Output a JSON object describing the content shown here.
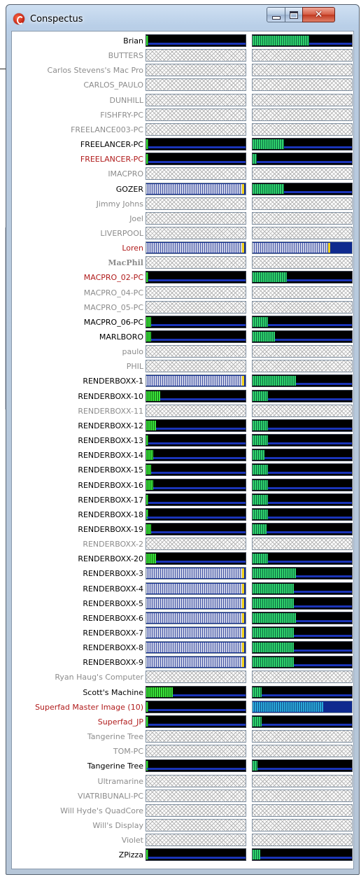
{
  "window": {
    "title": "Conspectus",
    "controls": {
      "minimize": "minimize",
      "maximize": "maximize",
      "close": "close"
    }
  },
  "colors": {
    "active_text": "#000000",
    "offline_text": "#8c8c8c",
    "error_text": "#b01c1c",
    "cpu_fill": "#3be23b",
    "mem_fill": "#2fd06b",
    "busy_fill": "#c9cfe6",
    "busy_cap": "#f2d21a",
    "graph_line": "#1e3dd8"
  },
  "machines": [
    {
      "name": "Brian",
      "state": "active",
      "cpu": 0.02,
      "mem": 0.58
    },
    {
      "name": "BUTTERS",
      "state": "offline"
    },
    {
      "name": "Carlos Stevens's Mac Pro",
      "state": "offline"
    },
    {
      "name": "CARLOS_PAULO",
      "state": "offline"
    },
    {
      "name": "DUNHILL",
      "state": "offline"
    },
    {
      "name": "FISHFRY-PC",
      "state": "offline"
    },
    {
      "name": "FREELANCE003-PC",
      "state": "offline"
    },
    {
      "name": "FREELANCER-PC",
      "state": "active",
      "cpu": 0.02,
      "mem": 0.32
    },
    {
      "name": "FREELANCER-PC",
      "state": "error",
      "cpu": 0.02,
      "mem": 0.04
    },
    {
      "name": "IMACPRO",
      "state": "offline"
    },
    {
      "name": "GOZER",
      "state": "busy",
      "cpu": 1.0,
      "mem": 0.32
    },
    {
      "name": "Jimmy Johns",
      "state": "offline"
    },
    {
      "name": "Joel",
      "state": "offline"
    },
    {
      "name": "LIVERPOOL",
      "state": "offline"
    },
    {
      "name": "Loren",
      "state": "error-busy",
      "cpu": 1.0,
      "mem": 0.77
    },
    {
      "name": "MacPhil",
      "state": "bold-offline"
    },
    {
      "name": "MACPRO_02-PC",
      "state": "error",
      "cpu": 0.02,
      "mem": 0.35
    },
    {
      "name": "MACPRO_04-PC",
      "state": "offline"
    },
    {
      "name": "MACPRO_05-PC",
      "state": "offline"
    },
    {
      "name": "MACPRO_06-PC",
      "state": "active",
      "cpu": 0.05,
      "mem": 0.16
    },
    {
      "name": "MARLBORO",
      "state": "active",
      "cpu": 0.05,
      "mem": 0.23
    },
    {
      "name": "paulo",
      "state": "offline"
    },
    {
      "name": "PHIL",
      "state": "offline"
    },
    {
      "name": "RENDERBOXX-1",
      "state": "busy",
      "cpu": 1.0,
      "mem": 0.44
    },
    {
      "name": "RENDERBOXX-10",
      "state": "active",
      "cpu": 0.14,
      "mem": 0.16
    },
    {
      "name": "RENDERBOXX-11",
      "state": "offline"
    },
    {
      "name": "RENDERBOXX-12",
      "state": "active",
      "cpu": 0.1,
      "mem": 0.16
    },
    {
      "name": "RENDERBOXX-13",
      "state": "active",
      "cpu": 0.02,
      "mem": 0.16
    },
    {
      "name": "RENDERBOXX-14",
      "state": "active",
      "cpu": 0.07,
      "mem": 0.12
    },
    {
      "name": "RENDERBOXX-15",
      "state": "active",
      "cpu": 0.05,
      "mem": 0.16
    },
    {
      "name": "RENDERBOXX-16",
      "state": "active",
      "cpu": 0.07,
      "mem": 0.16
    },
    {
      "name": "RENDERBOXX-17",
      "state": "active",
      "cpu": 0.02,
      "mem": 0.16
    },
    {
      "name": "RENDERBOXX-18",
      "state": "active",
      "cpu": 0.01,
      "mem": 0.16
    },
    {
      "name": "RENDERBOXX-19",
      "state": "active",
      "cpu": 0.05,
      "mem": 0.14
    },
    {
      "name": "RENDERBOXX-2",
      "state": "offline"
    },
    {
      "name": "RENDERBOXX-20",
      "state": "active",
      "cpu": 0.1,
      "mem": 0.16
    },
    {
      "name": "RENDERBOXX-3",
      "state": "busy",
      "cpu": 1.0,
      "mem": 0.44
    },
    {
      "name": "RENDERBOXX-4",
      "state": "busy",
      "cpu": 1.0,
      "mem": 0.42
    },
    {
      "name": "RENDERBOXX-5",
      "state": "busy",
      "cpu": 1.0,
      "mem": 0.42
    },
    {
      "name": "RENDERBOXX-6",
      "state": "busy",
      "cpu": 1.0,
      "mem": 0.44
    },
    {
      "name": "RENDERBOXX-7",
      "state": "busy",
      "cpu": 1.0,
      "mem": 0.42
    },
    {
      "name": "RENDERBOXX-8",
      "state": "busy",
      "cpu": 1.0,
      "mem": 0.42
    },
    {
      "name": "RENDERBOXX-9",
      "state": "busy",
      "cpu": 1.0,
      "mem": 0.42
    },
    {
      "name": "Ryan Haug's Computer",
      "state": "offline"
    },
    {
      "name": "Scott's Machine",
      "state": "active",
      "cpu": 0.27,
      "mem": 0.09
    },
    {
      "name": "Superfad Master Image (10)",
      "state": "error-blue",
      "cpu": 0.02,
      "mem": 0.72
    },
    {
      "name": "Superfad_JP",
      "state": "error",
      "cpu": 0.02,
      "mem": 0.09
    },
    {
      "name": "Tangerine Tree",
      "state": "offline"
    },
    {
      "name": "TOM-PC",
      "state": "offline"
    },
    {
      "name": "Tangerine Tree",
      "state": "active",
      "cpu": 0.01,
      "mem": 0.05
    },
    {
      "name": "Ultramarine",
      "state": "offline"
    },
    {
      "name": "VIATRIBUNALI-PC",
      "state": "offline"
    },
    {
      "name": "Will Hyde's QuadCore",
      "state": "offline"
    },
    {
      "name": "Will's Display",
      "state": "offline"
    },
    {
      "name": "Violet",
      "state": "offline"
    },
    {
      "name": "ZPizza",
      "state": "active",
      "cpu": 0.02,
      "mem": 0.08
    }
  ]
}
